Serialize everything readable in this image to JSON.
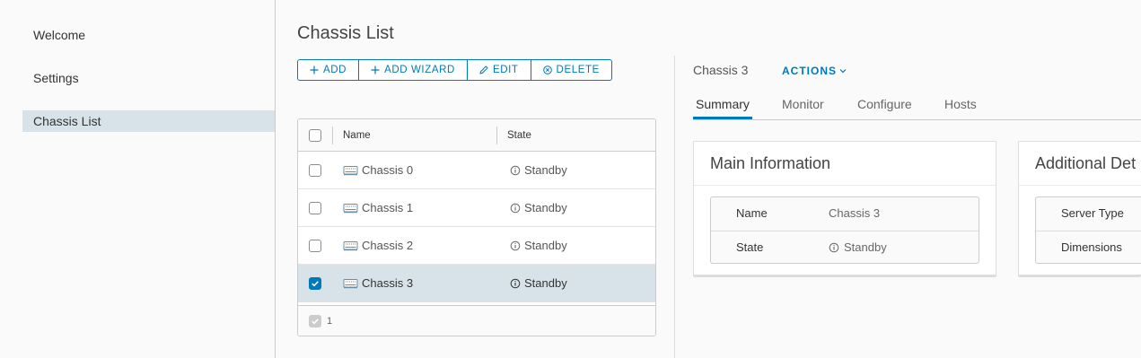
{
  "sidebar": {
    "items": [
      {
        "label": "Welcome"
      },
      {
        "label": "Settings"
      },
      {
        "label": "Chassis List"
      }
    ]
  },
  "page": {
    "title": "Chassis List"
  },
  "toolbar": {
    "add": "ADD",
    "add_wizard": "ADD WIZARD",
    "edit": "EDIT",
    "delete": "DELETE"
  },
  "grid": {
    "columns": [
      "Name",
      "State"
    ],
    "rows": [
      {
        "name": "Chassis 0",
        "state": "Standby",
        "selected": false
      },
      {
        "name": "Chassis 1",
        "state": "Standby",
        "selected": false
      },
      {
        "name": "Chassis 2",
        "state": "Standby",
        "selected": false
      },
      {
        "name": "Chassis 3",
        "state": "Standby",
        "selected": true
      }
    ],
    "footer_selected_count": "1"
  },
  "detail": {
    "title": "Chassis 3",
    "actions_label": "ACTIONS",
    "tabs": [
      "Summary",
      "Monitor",
      "Configure",
      "Hosts"
    ],
    "active_tab": "Summary",
    "main_card": {
      "title": "Main Information",
      "rows": [
        {
          "key": "Name",
          "value": "Chassis 3"
        },
        {
          "key": "State",
          "value": "Standby"
        }
      ]
    },
    "additional_card": {
      "title": "Additional Det",
      "rows": [
        {
          "key": "Server Type"
        },
        {
          "key": "Dimensions"
        }
      ]
    }
  },
  "colors": {
    "accent": "#0079b8",
    "selected_row": "#d8e3e9"
  }
}
